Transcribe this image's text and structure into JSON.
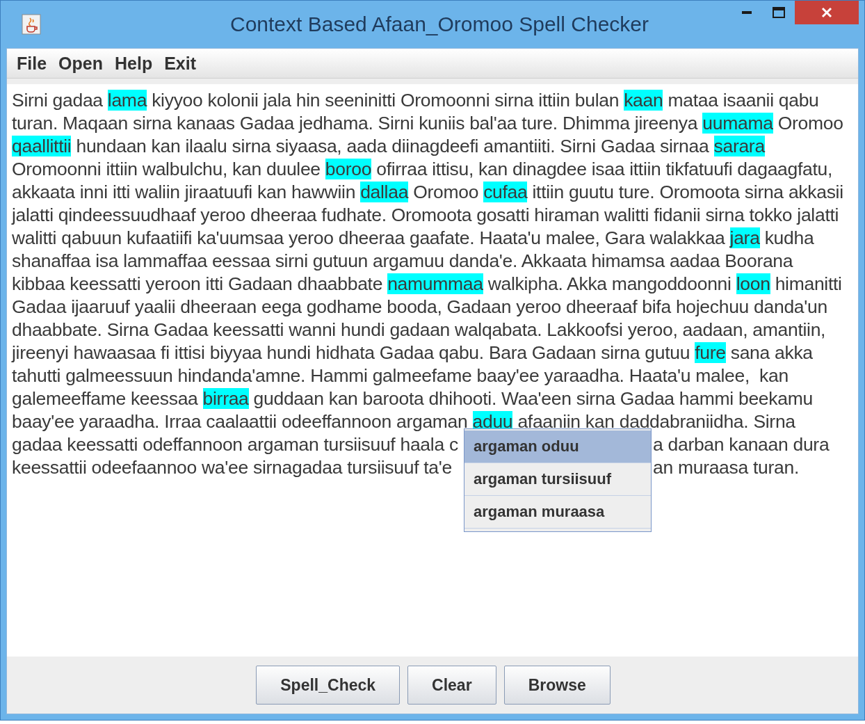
{
  "window": {
    "title": "Context Based Afaan_Oromoo Spell Checker"
  },
  "menu": [
    {
      "label": "File"
    },
    {
      "label": "Open"
    },
    {
      "label": "Help"
    },
    {
      "label": "Exit"
    }
  ],
  "text_lines": [
    {
      "segments": [
        {
          "text": "Sirni gadaa ",
          "flagged": false
        },
        {
          "text": "lama",
          "flagged": true
        },
        {
          "text": " kiyyoo kolonii jala hin seeninitti Oromoonni sirna ittiin bulan ",
          "flagged": false
        },
        {
          "text": "kaan",
          "flagged": true
        },
        {
          "text": " mataa isaanii qabu",
          "flagged": false
        }
      ]
    },
    {
      "segments": [
        {
          "text": "turan. Maqaan sirna kanaas Gadaa jedhama. Sirni kuniis bal'aa ture. Dhimma jireenya ",
          "flagged": false
        },
        {
          "text": "uumama",
          "flagged": true
        },
        {
          "text": " Oromoo",
          "flagged": false
        }
      ]
    },
    {
      "segments": [
        {
          "text": "qaallittii",
          "flagged": true
        },
        {
          "text": " hundaan kan ilaalu sirna siyaasa, aada diinagdeefi amantiiti. Sirni Gadaa sirnaa ",
          "flagged": false
        },
        {
          "text": "sarara",
          "flagged": true
        }
      ]
    },
    {
      "segments": [
        {
          "text": "Oromoonni ittiin walbulchu, kan duulee ",
          "flagged": false
        },
        {
          "text": "boroo",
          "flagged": true
        },
        {
          "text": " ofirraa ittisu, kan dinagdee isaa ittiin tikfatuufi dagaagfatu,",
          "flagged": false
        }
      ]
    },
    {
      "segments": [
        {
          "text": "akkaata inni itti waliin jiraatuufi kan hawwiin ",
          "flagged": false
        },
        {
          "text": "dallaa",
          "flagged": true
        },
        {
          "text": " Oromoo ",
          "flagged": false
        },
        {
          "text": "cufaa",
          "flagged": true
        },
        {
          "text": " ittiin guutu ture. Oromoota sirna akkasii",
          "flagged": false
        }
      ]
    },
    {
      "segments": [
        {
          "text": "jalatti qindeessuudhaaf yeroo dheeraa fudhate. Oromoota gosatti hiraman walitti fidanii sirna tokko jalatti",
          "flagged": false
        }
      ]
    },
    {
      "segments": [
        {
          "text": "walitti qabuun kufaatiifi ka'uumsaa yeroo dheeraa gaafate. Haata'u malee, Gara walakkaa ",
          "flagged": false
        },
        {
          "text": "jara",
          "flagged": true
        },
        {
          "text": " kudha",
          "flagged": false
        }
      ]
    },
    {
      "segments": [
        {
          "text": "shanaffaa isa lammaffaa eessaa sirni gutuun argamuu danda'e. Akkaata himamsa aadaa Boorana",
          "flagged": false
        }
      ]
    },
    {
      "segments": [
        {
          "text": "kibbaa keessatti yeroon itti Gadaan dhaabbate ",
          "flagged": false
        },
        {
          "text": "namummaa",
          "flagged": true
        },
        {
          "text": " walkipha. Akka mangoddoonni ",
          "flagged": false
        },
        {
          "text": "loon",
          "flagged": true
        },
        {
          "text": " himanitti",
          "flagged": false
        }
      ]
    },
    {
      "segments": [
        {
          "text": "Gadaa ijaaruuf yaalii dheeraan eega godhame booda, Gadaan yeroo dheeraaf bifa hojechuu danda'un",
          "flagged": false
        }
      ]
    },
    {
      "segments": [
        {
          "text": "dhaabbate. Sirna Gadaa keessatti wanni hundi gadaan walqabata. Lakkoofsi yeroo, aadaan, amantiin,",
          "flagged": false
        }
      ]
    },
    {
      "segments": [
        {
          "text": "jireenyi hawaasaa fi ittisi biyyaa hundi hidhata Gadaa qabu. Bara Gadaan sirna gutuu ",
          "flagged": false
        },
        {
          "text": "fure",
          "flagged": true
        },
        {
          "text": " sana akka",
          "flagged": false
        }
      ]
    },
    {
      "segments": [
        {
          "text": "tahutti galmeessuun hindanda'amne. Hammi galmeefame baay'ee yaraadha. Haata'u malee,  kan",
          "flagged": false
        }
      ]
    },
    {
      "segments": [
        {
          "text": "galemeeffame keessaa ",
          "flagged": false
        },
        {
          "text": "birraa",
          "flagged": true
        },
        {
          "text": " guddaan kan baroota dhihooti. Waa'een sirna Gadaa hammi beekamu",
          "flagged": false
        }
      ]
    },
    {
      "segments": [
        {
          "text": "baay'ee yaraadha. Irraa caalaattii odeeffannoon argaman ",
          "flagged": false
        },
        {
          "text": "aduu",
          "flagged": true
        },
        {
          "text": " afaaniin kan daddabraniidha. Sirna",
          "flagged": false
        }
      ]
    },
    {
      "segments": [
        {
          "text": "gadaa keessatti odeffannoon argaman tursiisuuf haala c",
          "flagged": false
        }
      ],
      "segments_after": [
        {
          "text": "a darban kanaan dura",
          "flagged": false
        }
      ]
    },
    {
      "segments": [
        {
          "text": "keessattii odeefaannoo wa'ee sirnagadaa tursiisuuf ta'e",
          "flagged": false
        }
      ],
      "segments_after": [
        {
          "text": "an muraasa turan.",
          "flagged": false
        }
      ]
    }
  ],
  "suggestions": [
    {
      "label": "argaman oduu",
      "selected": true
    },
    {
      "label": "argaman tursiisuuf",
      "selected": false
    },
    {
      "label": "argaman muraasa",
      "selected": false
    }
  ],
  "buttons": [
    {
      "label": "Spell_Check"
    },
    {
      "label": "Clear"
    },
    {
      "label": "Browse"
    }
  ]
}
